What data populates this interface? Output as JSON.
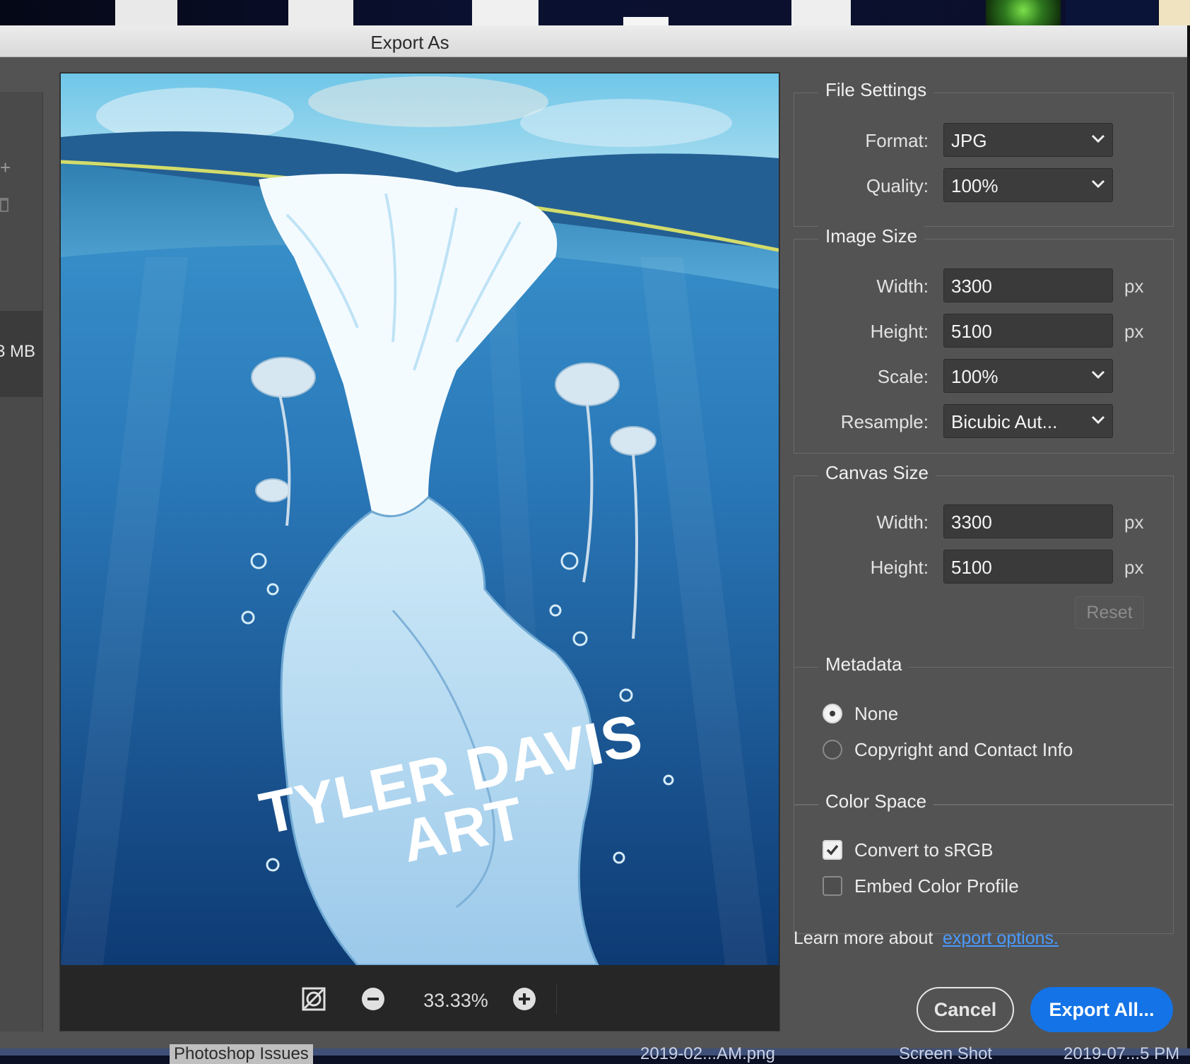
{
  "dialog": {
    "title": "Export As"
  },
  "sidebar": {
    "item_size": "3 MB"
  },
  "preview": {
    "watermark_line1": "TYLER DAVIS",
    "watermark_line2": "ART",
    "zoom_level": "33.33%"
  },
  "file_settings": {
    "title": "File Settings",
    "format_label": "Format:",
    "format_value": "JPG",
    "quality_label": "Quality:",
    "quality_value": "100%"
  },
  "image_size": {
    "title": "Image Size",
    "width_label": "Width:",
    "width_value": "3300",
    "height_label": "Height:",
    "height_value": "5100",
    "unit": "px",
    "scale_label": "Scale:",
    "scale_value": "100%",
    "resample_label": "Resample:",
    "resample_value": "Bicubic Aut..."
  },
  "canvas_size": {
    "title": "Canvas Size",
    "width_label": "Width:",
    "width_value": "3300",
    "height_label": "Height:",
    "height_value": "5100",
    "unit": "px",
    "reset_label": "Reset"
  },
  "metadata": {
    "title": "Metadata",
    "options": [
      "None",
      "Copyright and Contact Info"
    ],
    "selected": "None"
  },
  "color_space": {
    "title": "Color Space",
    "convert_label": "Convert to sRGB",
    "convert_checked": true,
    "embed_label": "Embed Color Profile",
    "embed_checked": false
  },
  "footer": {
    "learn_more": "Learn more about",
    "link_text": "export options.",
    "cancel_label": "Cancel",
    "export_label": "Export All..."
  },
  "desktop": {
    "bottom_labels": [
      "Photoshop Issues",
      "2019-02...AM.png",
      "Screen Shot",
      "2019-07...5 PM"
    ]
  },
  "colors": {
    "panel_bg": "#535353",
    "accent_blue": "#1473e6",
    "link_blue": "#4a9bff",
    "water_dark": "#0f3c72",
    "water_light": "#3a9ad2"
  }
}
